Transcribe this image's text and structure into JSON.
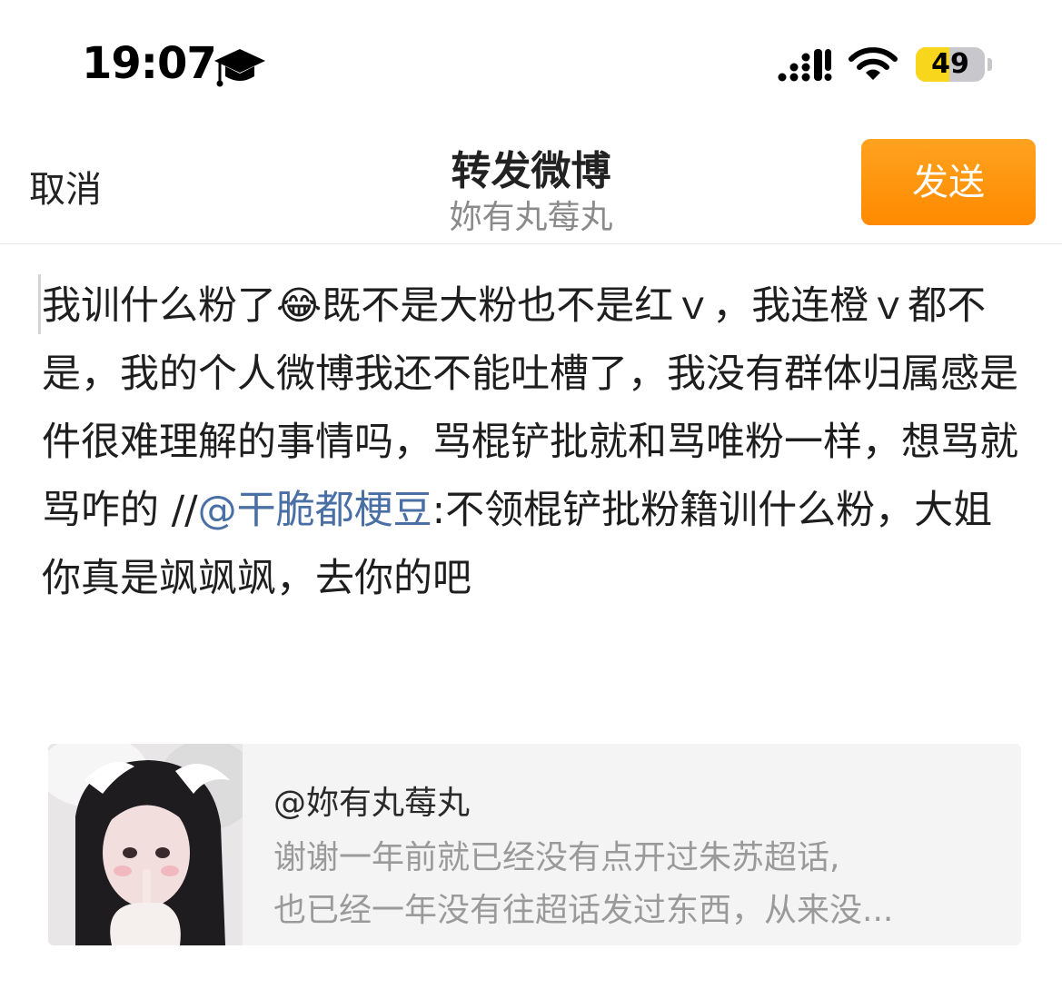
{
  "status_bar": {
    "time": "19:07",
    "battery_level": "49",
    "battery_fraction": 0.49,
    "icons": [
      "graduation-cap-icon",
      "cellular-signal-icon",
      "wifi-icon",
      "battery-icon"
    ]
  },
  "nav": {
    "cancel_label": "取消",
    "title": "转发微博",
    "subtitle": "妳有丸莓丸",
    "send_label": "发送",
    "send_color": "#ff8f0a"
  },
  "compose": {
    "text_before_emoji": "我训什么粉了",
    "emoji": "😂",
    "text_after_emoji": "既不是大粉也不是红ｖ，我连橙ｖ都不是，我的个人微博我还不能吐槽了，我没有群体归属感是件很难理解的事情吗，骂棍铲批就和骂唯粉一样，想骂就骂咋的 //",
    "mention": "@干脆都梗豆",
    "text_after_mention": ":不领棍铲批粉籍训什么粉，大姐你真是飒飒飒，去你的吧",
    "mention_color": "#4a6fa5"
  },
  "quote": {
    "user": "@妳有丸莓丸",
    "line1": "谢谢一年前就已经没有点开过朱苏超话,",
    "line2": "也已经一年没有往超话发过东西，从来没..."
  }
}
